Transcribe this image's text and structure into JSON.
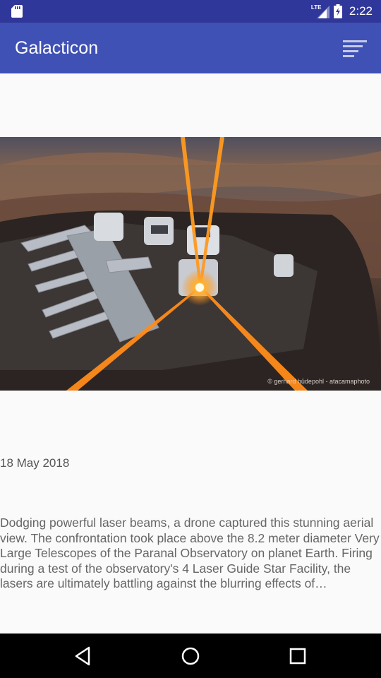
{
  "status_bar": {
    "time": "2:22",
    "network_label": "LTE",
    "icons": [
      "sd-card-icon",
      "lte-signal-icon",
      "battery-icon"
    ]
  },
  "app_bar": {
    "title": "Galacticon",
    "action_icon": "sort-icon"
  },
  "apod": {
    "image_credit": "© gerhard hüdepohl - atacamaphoto",
    "date": "18 May 2018",
    "description": "Dodging powerful laser beams, a drone captured this stunning aerial view. The confrontation took place above the 8.2 meter diameter Very Large Telescopes of the Paranal Observatory on planet Earth. Firing during a test of the observatory's 4 Laser Guide Star Facility, the lasers are ultimately battling against the blurring effects of atmospheric turbulence."
  },
  "nav_bar": {
    "icons": [
      "back-icon",
      "home-icon",
      "recent-apps-icon"
    ]
  },
  "colors": {
    "status_bar": "#30379a",
    "app_bar": "#3f51b5",
    "background": "#fafafa",
    "laser": "#ff8c1a"
  }
}
